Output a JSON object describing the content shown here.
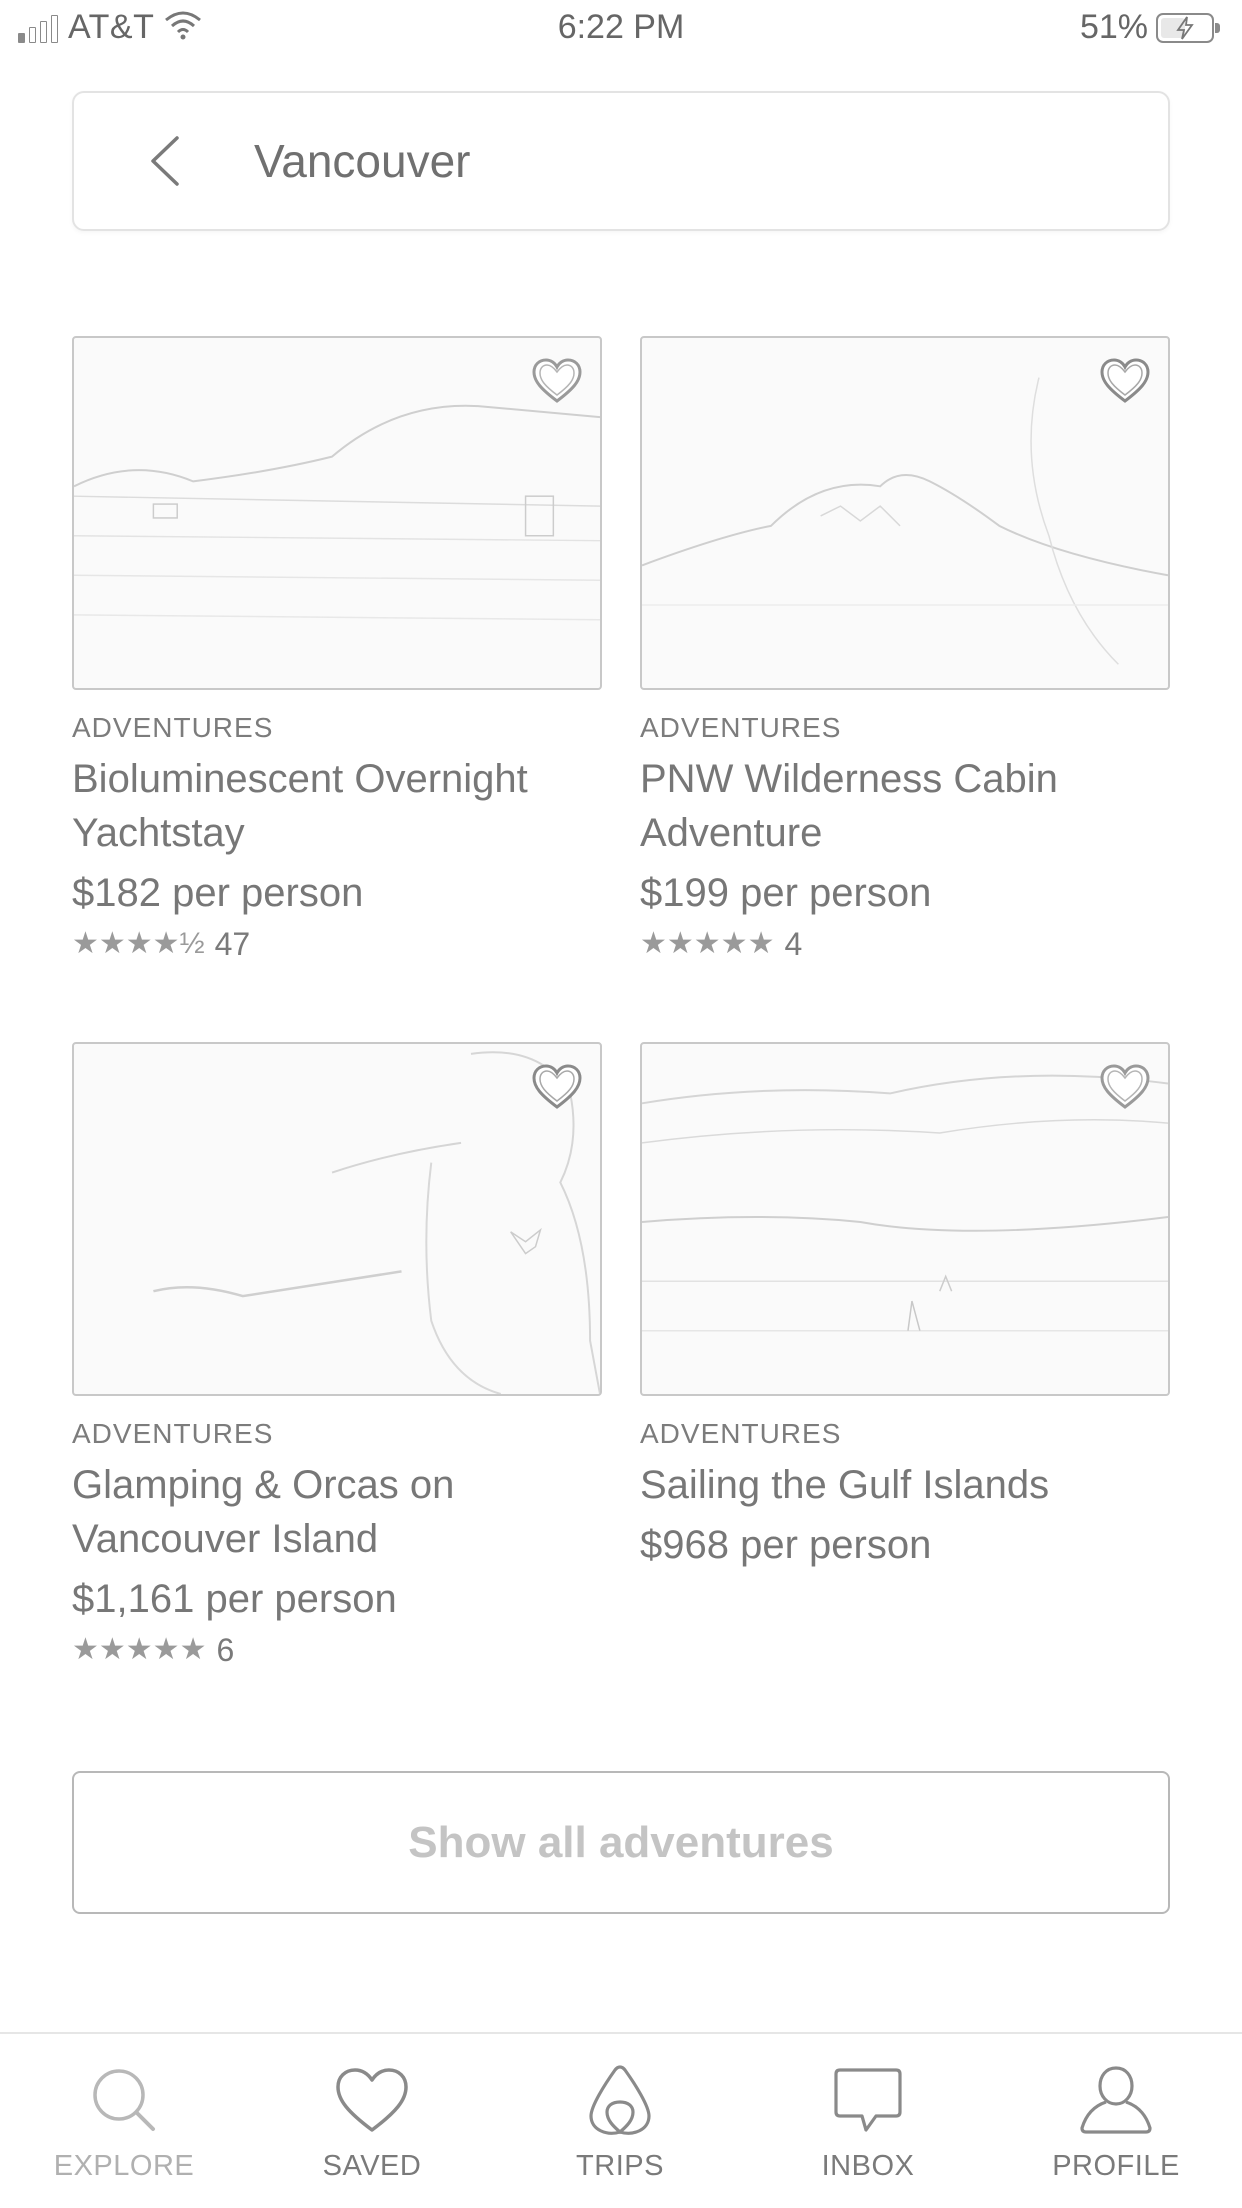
{
  "status_bar": {
    "carrier": "AT&T",
    "time": "6:22 PM",
    "battery_percent": "51%",
    "battery_level": 0.51,
    "signal_bars": 1,
    "icons": [
      "signal-icon",
      "wifi-icon",
      "battery-icon",
      "charging-icon"
    ]
  },
  "search": {
    "value": "Vancouver",
    "back_icon": "chevron-left-icon"
  },
  "listings": [
    {
      "category": "ADVENTURES",
      "title": "Bioluminescent Overnight Yachtstay",
      "price": "$182 per person",
      "stars": "★★★★½",
      "rating_value": 4.5,
      "reviews": "47"
    },
    {
      "category": "ADVENTURES",
      "title": "PNW Wilderness Cabin Adventure",
      "price": "$199 per person",
      "stars": "★★★★★",
      "rating_value": 5,
      "reviews": "4"
    },
    {
      "category": "ADVENTURES",
      "title": "Glamping & Orcas on Vancouver Island",
      "price": "$1,161 per person",
      "stars": "★★★★★",
      "rating_value": 5,
      "reviews": "6"
    },
    {
      "category": "ADVENTURES",
      "title": "Sailing the Gulf Islands",
      "price": "$968 per person"
    }
  ],
  "show_all": {
    "label": "Show all adventures"
  },
  "tabs": [
    {
      "label": "EXPLORE",
      "icon": "search-icon",
      "active": false
    },
    {
      "label": "SAVED",
      "icon": "heart-icon",
      "active": true
    },
    {
      "label": "TRIPS",
      "icon": "airbnb-logo-icon",
      "active": true
    },
    {
      "label": "INBOX",
      "icon": "message-icon",
      "active": true
    },
    {
      "label": "PROFILE",
      "icon": "profile-icon",
      "active": true
    }
  ],
  "colors": {
    "text": "#777777",
    "border": "#c8c8c8",
    "button_text": "#c4c4c4"
  }
}
